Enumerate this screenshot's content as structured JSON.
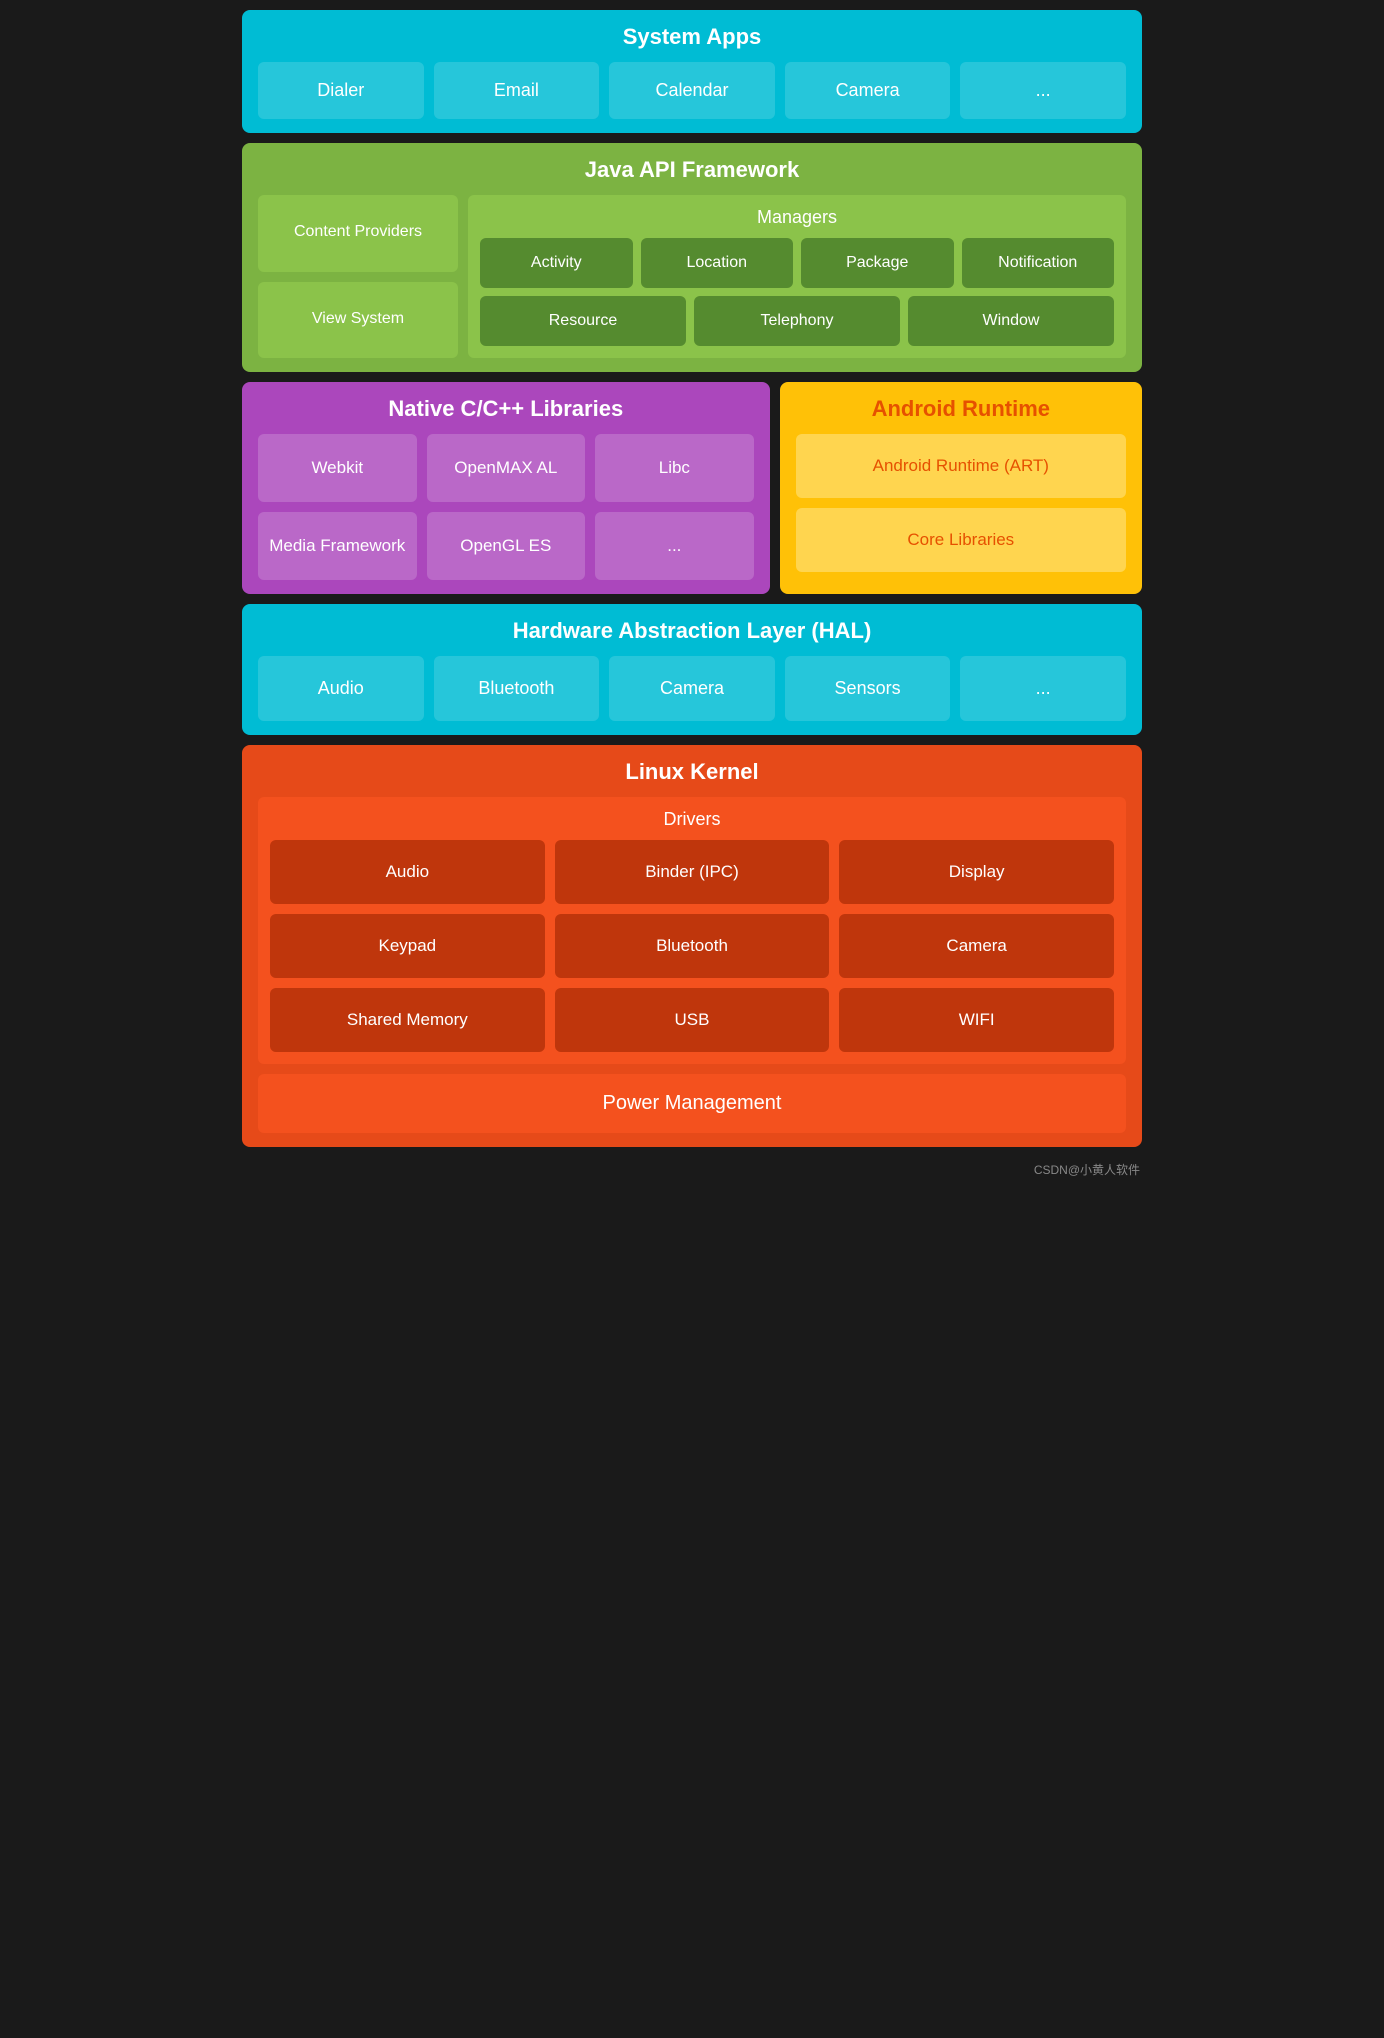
{
  "system_apps": {
    "title": "System Apps",
    "apps": [
      "Dialer",
      "Email",
      "Calendar",
      "Camera",
      "..."
    ]
  },
  "java_api": {
    "title": "Java API Framework",
    "left_items": [
      "Content Providers",
      "View System"
    ],
    "managers": {
      "title": "Managers",
      "row1": [
        "Activity",
        "Location",
        "Package",
        "Notification"
      ],
      "row2": [
        "Resource",
        "Telephony",
        "Window"
      ]
    }
  },
  "native_libs": {
    "title": "Native C/C++ Libraries",
    "items_row1": [
      "Webkit",
      "OpenMAX AL",
      "Libc"
    ],
    "items_row2": [
      "Media Framework",
      "OpenGL ES",
      "..."
    ]
  },
  "android_runtime": {
    "title": "Android Runtime",
    "items": [
      "Android Runtime (ART)",
      "Core Libraries"
    ]
  },
  "hal": {
    "title": "Hardware Abstraction Layer (HAL)",
    "items": [
      "Audio",
      "Bluetooth",
      "Camera",
      "Sensors",
      "..."
    ]
  },
  "linux_kernel": {
    "title": "Linux Kernel",
    "drivers": {
      "title": "Drivers",
      "items": [
        [
          "Audio",
          "Binder (IPC)",
          "Display"
        ],
        [
          "Keypad",
          "Bluetooth",
          "Camera"
        ],
        [
          "Shared Memory",
          "USB",
          "WIFI"
        ]
      ]
    },
    "power_management": "Power Management"
  },
  "watermark": "CSDN@小黄人软件"
}
